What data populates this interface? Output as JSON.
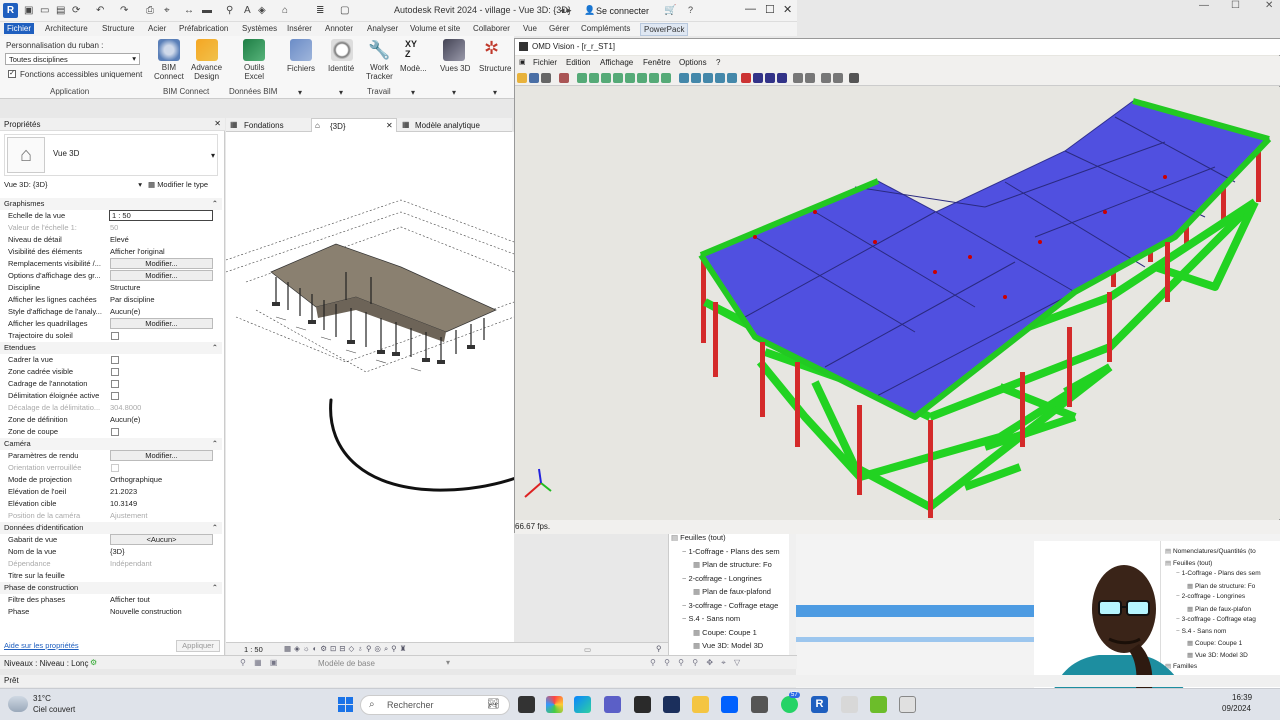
{
  "revit": {
    "title": "Autodesk Revit 2024 - village - Vue 3D: {3D}",
    "sign_in": "Se connecter",
    "help": "?",
    "tabs": [
      "Fichier",
      "Architecture",
      "Structure",
      "Acier",
      "Préfabrication",
      "Systèmes",
      "Insérer",
      "Annoter",
      "Analyser",
      "Volume et site",
      "Collaborer",
      "Vue",
      "Gérer",
      "Compléments",
      "PowerPack"
    ],
    "ribbon": {
      "personalization_label": "Personnalisation du ruban :",
      "discipline_value": "Toutes disciplines",
      "accessible_label": "Fonctions accessibles uniquement",
      "application_label": "Application",
      "bim_connect": "BIM\nConnect",
      "advance_design": "Advance\nDesign",
      "bim_connect_group": "BIM Connect",
      "outils_excel": "Outils\nExcel",
      "donnees_bim": "Données BIM",
      "fichiers": "Fichiers",
      "identite": "Identité",
      "work_tracker": "Work\nTracker",
      "travail": "Travail",
      "modele": "Modè...",
      "vues3d": "Vues 3D",
      "structure": "Structure"
    },
    "properties": {
      "title": "Propriétés",
      "type_name": "Vue 3D",
      "instance_selector": "Vue 3D: {3D}",
      "edit_type": "Modifier le type",
      "help_link": "Aide sur les propriétés",
      "apply": "Appliquer",
      "rows": [
        {
          "k": "Graphismes",
          "type": "sec"
        },
        {
          "k": "Echelle de la vue",
          "v": "1 : 50",
          "type": "input"
        },
        {
          "k": "Valeur de l'échelle    1:",
          "v": "50",
          "type": "dim"
        },
        {
          "k": "Niveau de détail",
          "v": "Elevé"
        },
        {
          "k": "Visibilité des éléments",
          "v": "Afficher l'original"
        },
        {
          "k": "Remplacements visibilité /...",
          "v": "Modifier...",
          "type": "btn"
        },
        {
          "k": "Options d'affichage des gr...",
          "v": "Modifier...",
          "type": "btn"
        },
        {
          "k": "Discipline",
          "v": "Structure"
        },
        {
          "k": "Afficher les lignes cachées",
          "v": "Par discipline"
        },
        {
          "k": "Style d'affichage de l'analy...",
          "v": "Aucun(e)"
        },
        {
          "k": "Afficher les quadrillages",
          "v": "Modifier...",
          "type": "btn"
        },
        {
          "k": "Trajectoire du soleil",
          "type": "chk"
        },
        {
          "k": "Etendues",
          "type": "sec"
        },
        {
          "k": "Cadrer la vue",
          "type": "chk"
        },
        {
          "k": "Zone cadrée visible",
          "type": "chk"
        },
        {
          "k": "Cadrage de l'annotation",
          "type": "chk"
        },
        {
          "k": "Délimitation éloignée active",
          "type": "chk"
        },
        {
          "k": "Décalage de la délimitatio...",
          "v": "304.8000",
          "type": "dim"
        },
        {
          "k": "Zone de définition",
          "v": "Aucun(e)"
        },
        {
          "k": "Zone de coupe",
          "type": "chk"
        },
        {
          "k": "Caméra",
          "type": "sec"
        },
        {
          "k": "Paramètres de rendu",
          "v": "Modifier...",
          "type": "btn"
        },
        {
          "k": "Orientation verrouillée",
          "type": "chkdim"
        },
        {
          "k": "Mode de projection",
          "v": "Orthographique"
        },
        {
          "k": "Elévation de l'oeil",
          "v": "21.2023"
        },
        {
          "k": "Elévation cible",
          "v": "10.3149"
        },
        {
          "k": "Position de la caméra",
          "v": "Ajustement",
          "type": "dim"
        },
        {
          "k": "Données d'identification",
          "type": "sec"
        },
        {
          "k": "Gabarit de vue",
          "v": "<Aucun>",
          "type": "btn"
        },
        {
          "k": "Nom de la vue",
          "v": "{3D}"
        },
        {
          "k": "Dépendance",
          "v": "Indépendant",
          "type": "dim"
        },
        {
          "k": "Titre sur la feuille",
          "v": ""
        },
        {
          "k": "Phase de construction",
          "type": "sec"
        },
        {
          "k": "Filtre des phases",
          "v": "Afficher tout"
        },
        {
          "k": "Phase",
          "v": "Nouvelle construction"
        }
      ]
    },
    "view_tabs": [
      "Fondations",
      "{3D}",
      "Modèle analytique"
    ],
    "view_scale": "1 : 50",
    "status_level": "Niveaux : Niveau : Lonç",
    "status_model": "Modèle de base",
    "status_count": ":0",
    "ready": "Prêt"
  },
  "omd": {
    "title": "OMD Vision - [r_r_ST1]",
    "menu": [
      "Fichier",
      "Edition",
      "Affichage",
      "Fenêtre",
      "Options",
      "?"
    ],
    "fps": "66.67 fps."
  },
  "browser": {
    "items": [
      {
        "t": "Feuilles (tout)",
        "lvl": 0
      },
      {
        "t": "1-Coffrage - Plans des sem",
        "lvl": 1
      },
      {
        "t": "Plan de structure: Fo",
        "lvl": 2
      },
      {
        "t": "2-coffrage - Longrines",
        "lvl": 1
      },
      {
        "t": "Plan de faux-plafond",
        "lvl": 2
      },
      {
        "t": "3-coffrage - Coffrage etage",
        "lvl": 1
      },
      {
        "t": "S.4 - Sans nom",
        "lvl": 1
      },
      {
        "t": "Coupe: Coupe 1",
        "lvl": 2
      },
      {
        "t": "Vue 3D: Model 3D",
        "lvl": 2
      }
    ]
  },
  "webcam_browser": {
    "items": [
      {
        "t": "Nomenclatures/Quantités (to",
        "lvl": 0
      },
      {
        "t": "Feuilles (tout)",
        "lvl": 0
      },
      {
        "t": "1-Coffrage - Plans des sem",
        "lvl": 1
      },
      {
        "t": "Plan de structure: Fo",
        "lvl": 2
      },
      {
        "t": "2-coffrage - Longrines",
        "lvl": 1
      },
      {
        "t": "Plan de faux-plafon",
        "lvl": 2
      },
      {
        "t": "3-coffrage - Coffrage etag",
        "lvl": 1
      },
      {
        "t": "S.4 - Sans nom",
        "lvl": 1
      },
      {
        "t": "Coupe: Coupe 1",
        "lvl": 2
      },
      {
        "t": "Vue 3D: Model 3D",
        "lvl": 2
      },
      {
        "t": "Familles",
        "lvl": 0
      },
      {
        "t": "Groupes",
        "lvl": 0
      }
    ]
  },
  "taskbar": {
    "weather_temp": "31°C",
    "weather_desc": "Ciel couvert",
    "search": "Rechercher",
    "time": "16:39",
    "date": "09/2024",
    "badge": "57"
  }
}
